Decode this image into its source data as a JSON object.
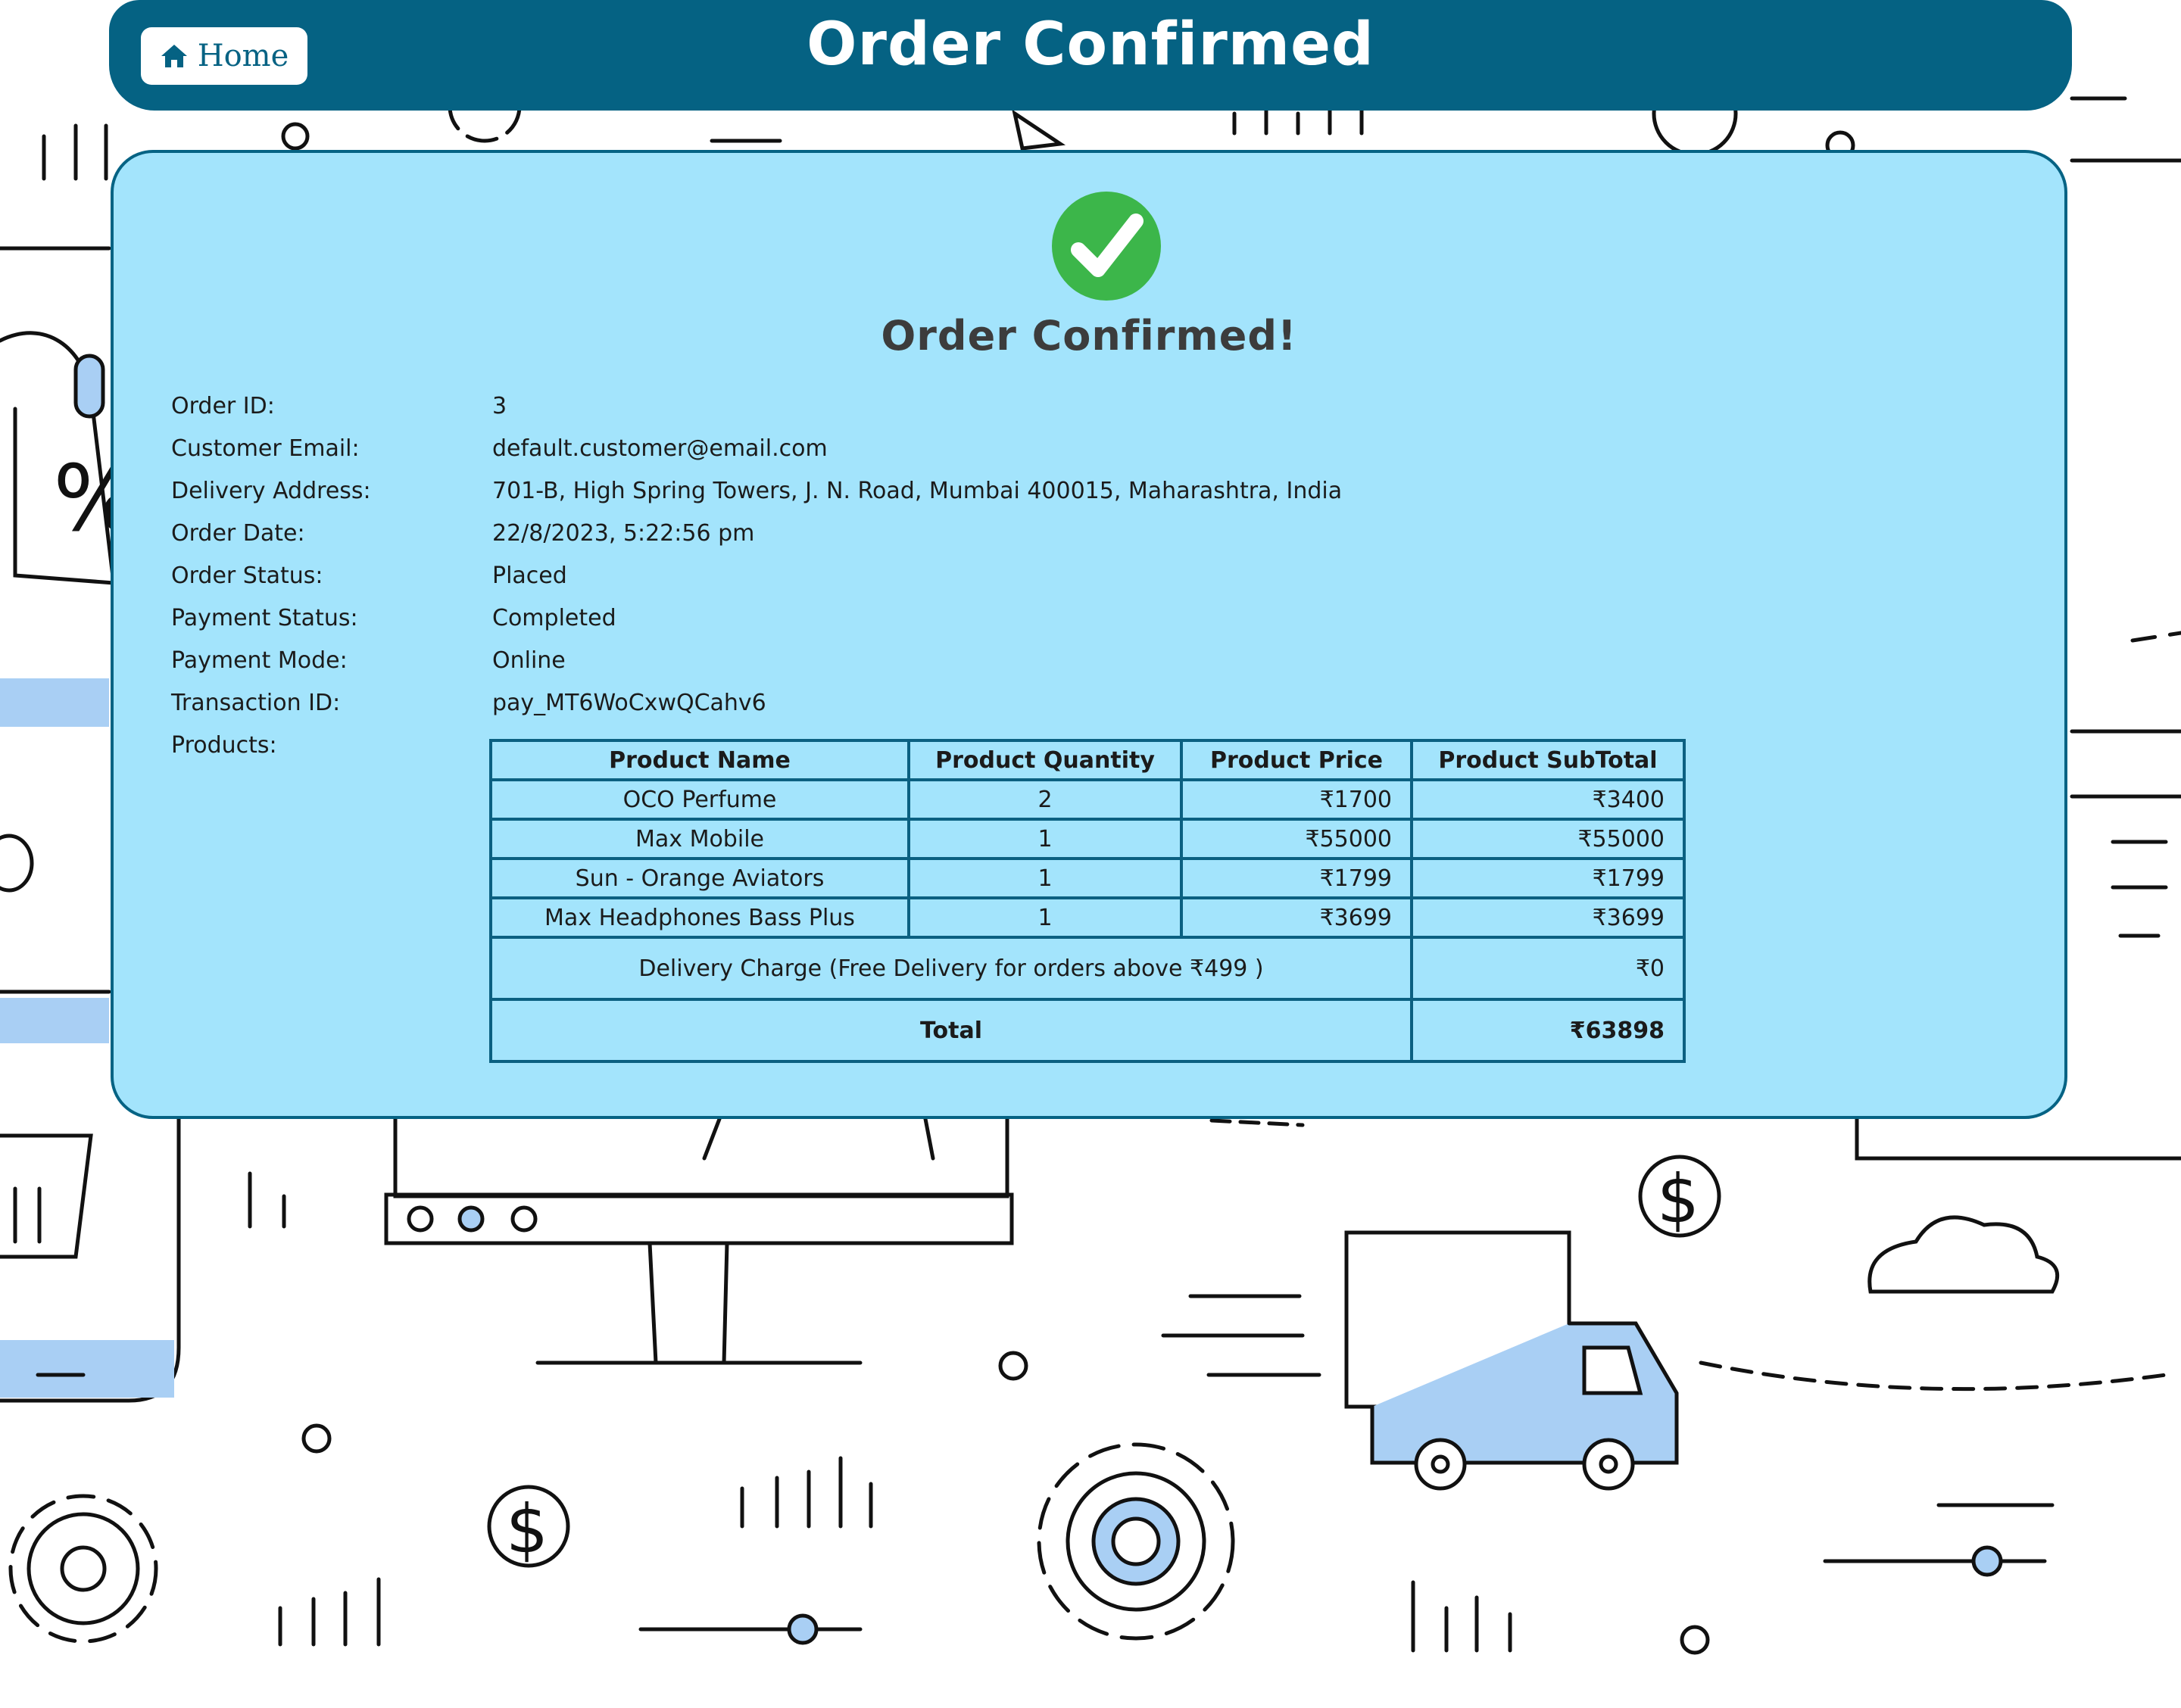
{
  "header": {
    "home_label": "Home",
    "title": "Order Confirmed"
  },
  "card": {
    "heading": "Order Confirmed!",
    "check_icon": "check-circle-icon",
    "accent_color": "#3cb64a"
  },
  "order": {
    "fields": [
      {
        "label": "Order ID:",
        "value": "3"
      },
      {
        "label": "Customer Email:",
        "value": "default.customer@email.com"
      },
      {
        "label": "Delivery Address:",
        "value": "701-B, High Spring Towers, J. N. Road, Mumbai 400015, Maharashtra, India"
      },
      {
        "label": "Order Date:",
        "value": "22/8/2023, 5:22:56 pm"
      },
      {
        "label": "Order Status:",
        "value": "Placed"
      },
      {
        "label": "Payment Status:",
        "value": "Completed"
      },
      {
        "label": "Payment Mode:",
        "value": "Online"
      },
      {
        "label": "Transaction ID:",
        "value": "pay_MT6WoCxwQCahv6"
      },
      {
        "label": "Products:",
        "value": ""
      }
    ]
  },
  "products": {
    "headers": [
      "Product Name",
      "Product Quantity",
      "Product Price",
      "Product SubTotal"
    ],
    "rows": [
      [
        "OCO Perfume",
        "2",
        "₹1700",
        "₹3400"
      ],
      [
        "Max Mobile",
        "1",
        "₹55000",
        "₹55000"
      ],
      [
        "Sun - Orange Aviators",
        "1",
        "₹1799",
        "₹1799"
      ],
      [
        "Max Headphones Bass Plus",
        "1",
        "₹3699",
        "₹3699"
      ]
    ],
    "delivery_label": "Delivery Charge (Free Delivery for orders above ₹499 )",
    "delivery_value": "₹0",
    "total_label": "Total",
    "total_value": "₹63898"
  },
  "colors": {
    "header_bg": "#056283",
    "card_bg": "#a3e4fc",
    "border": "#066384"
  }
}
